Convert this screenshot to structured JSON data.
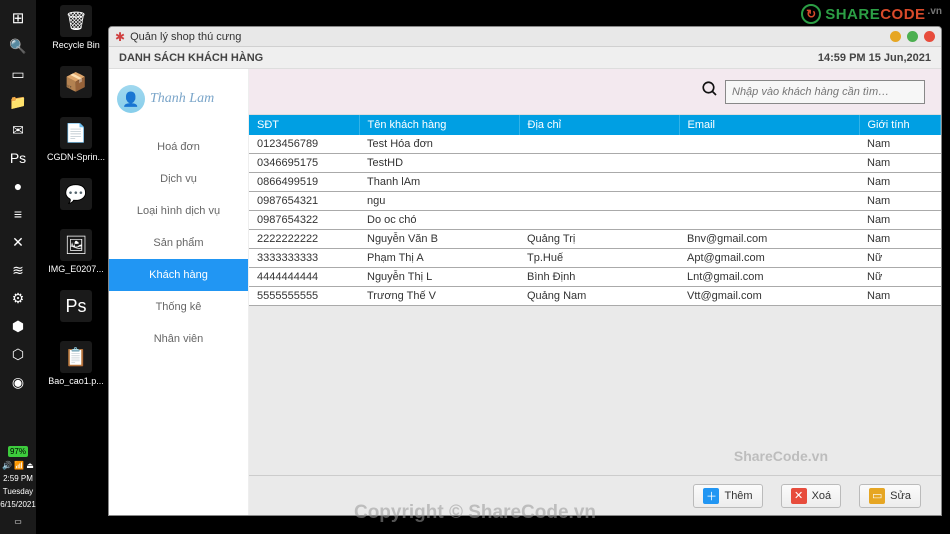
{
  "logo": {
    "share": "SHARE",
    "code": "CODE",
    "suffix": ".vn",
    "glyph": "↻"
  },
  "desktop_icons": [
    {
      "label": "Recycle Bin",
      "glyph": "🗑"
    },
    {
      "label": "",
      "glyph": "📦"
    },
    {
      "label": "CGDN-Sprin...",
      "glyph": "📄"
    },
    {
      "label": "",
      "glyph": "💬"
    },
    {
      "label": "IMG_E0207...",
      "glyph": "🖼"
    },
    {
      "label": "",
      "glyph": "Ps"
    },
    {
      "label": "Bao_cao1.p...",
      "glyph": "📋"
    }
  ],
  "taskbar": {
    "items": [
      "⊞",
      "🔍",
      "▭",
      "📁",
      "✉",
      "Ps",
      "●",
      "≡",
      "✕",
      "≋",
      "⚙",
      "⬢",
      "⬡",
      "◉"
    ],
    "battery": "97%",
    "tray": [
      "🔊",
      "📶",
      "⏏"
    ],
    "time": "2:59 PM",
    "day": "Tuesday",
    "date": "6/15/2021"
  },
  "window": {
    "title": "Quản lý shop thú cưng",
    "header_title": "DANH SÁCH KHÁCH HÀNG",
    "datetime": "14:59 PM  15 Jun,2021",
    "user_name": "Thanh Lam",
    "search_placeholder": "Nhập vào khách hàng cần tìm…",
    "nav": [
      {
        "label": "Hoá đơn",
        "active": false
      },
      {
        "label": "Dịch vụ",
        "active": false
      },
      {
        "label": "Loại hình dịch vụ",
        "active": false
      },
      {
        "label": "Sản phẩm",
        "active": false
      },
      {
        "label": "Khách hàng",
        "active": true
      },
      {
        "label": "Thống kê",
        "active": false
      },
      {
        "label": "Nhân viên",
        "active": false
      }
    ],
    "columns": [
      "SĐT",
      "Tên khách hàng",
      "Địa chỉ",
      "Email",
      "Giới tính"
    ],
    "column_widths": [
      "110px",
      "160px",
      "160px",
      "180px",
      "auto"
    ],
    "rows": [
      {
        "sdt": "0123456789",
        "ten": "Test Hóa đơn",
        "diachi": "",
        "email": "",
        "gioitinh": "Nam"
      },
      {
        "sdt": "0346695175",
        "ten": "TestHD",
        "diachi": "",
        "email": "",
        "gioitinh": "Nam"
      },
      {
        "sdt": "0866499519",
        "ten": "Thanh lAm",
        "diachi": "",
        "email": "",
        "gioitinh": "Nam"
      },
      {
        "sdt": "0987654321",
        "ten": "ngu",
        "diachi": "",
        "email": "",
        "gioitinh": "Nam"
      },
      {
        "sdt": "0987654322",
        "ten": "Do oc chó",
        "diachi": "",
        "email": "",
        "gioitinh": "Nam"
      },
      {
        "sdt": "2222222222",
        "ten": "Nguyễn Văn B",
        "diachi": "Quảng Trị",
        "email": "Bnv@gmail.com",
        "gioitinh": "Nam"
      },
      {
        "sdt": "3333333333",
        "ten": "Phạm Thị A",
        "diachi": "Tp.Huế",
        "email": "Apt@gmail.com",
        "gioitinh": "Nữ"
      },
      {
        "sdt": "4444444444",
        "ten": "Nguyễn Thị L",
        "diachi": "Bình Định",
        "email": "Lnt@gmail.com",
        "gioitinh": "Nữ"
      },
      {
        "sdt": "5555555555",
        "ten": "Trương Thế V",
        "diachi": "Quảng Nam",
        "email": "Vtt@gmail.com",
        "gioitinh": "Nam"
      }
    ],
    "actions": {
      "add": "Thêm",
      "delete": "Xoá",
      "edit": "Sửa"
    }
  },
  "watermarks": {
    "small": "ShareCode.vn",
    "main": "Copyright © ShareCode.vn"
  }
}
